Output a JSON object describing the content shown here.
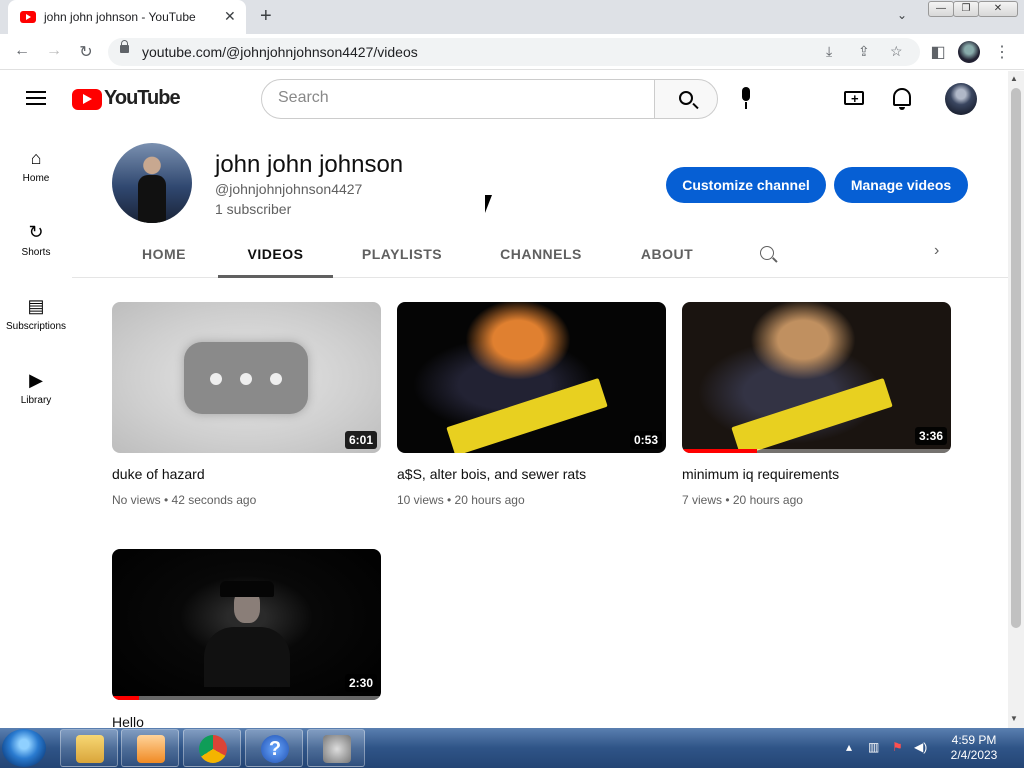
{
  "browser": {
    "tab_title": "john john johnson - YouTube",
    "tab_close": "✕",
    "new_tab": "+",
    "tab_menu": "⌄",
    "url": "youtube.com/@johnjohnjohnson4427/videos",
    "window_buttons": [
      "—",
      "❐",
      "✕"
    ]
  },
  "youtube": {
    "wordmark": "YouTube",
    "search_placeholder": "Search",
    "create_glyph": "+",
    "guide": [
      {
        "icon": "⌂",
        "label": "Home"
      },
      {
        "icon": "↻",
        "label": "Shorts"
      },
      {
        "icon": "▤",
        "label": "Subscriptions"
      },
      {
        "icon": "▶",
        "label": "Library"
      }
    ]
  },
  "channel": {
    "name": "john john johnson",
    "handle": "@johnjohnjohnson4427",
    "subscribers": "1 subscriber",
    "customize_label": "Customize channel",
    "manage_label": "Manage videos",
    "tabs": [
      "HOME",
      "VIDEOS",
      "PLAYLISTS",
      "CHANNELS",
      "ABOUT"
    ],
    "active_tab": "VIDEOS",
    "tab_next": "›"
  },
  "videos": [
    {
      "title": "duke of hazard",
      "meta": "No views • 42 seconds ago",
      "duration": "6:01",
      "progress": 0
    },
    {
      "title": "a$S, alter bois, and sewer rats",
      "meta": "10 views • 20 hours ago",
      "duration": "0:53",
      "progress": 0
    },
    {
      "title": "minimum iq requirements",
      "meta": "7 views • 20 hours ago",
      "duration": "3:36",
      "progress": 0.28
    },
    {
      "title": "Hello",
      "meta": "",
      "duration": "2:30",
      "progress": 0.1
    }
  ],
  "taskbar": {
    "time": "4:59 PM",
    "date": "2/4/2023",
    "tray_arrow": "▴"
  },
  "colors": {
    "accent": "#065fd4",
    "brand_red": "#ff0000",
    "taskbar": "#2f5487"
  }
}
